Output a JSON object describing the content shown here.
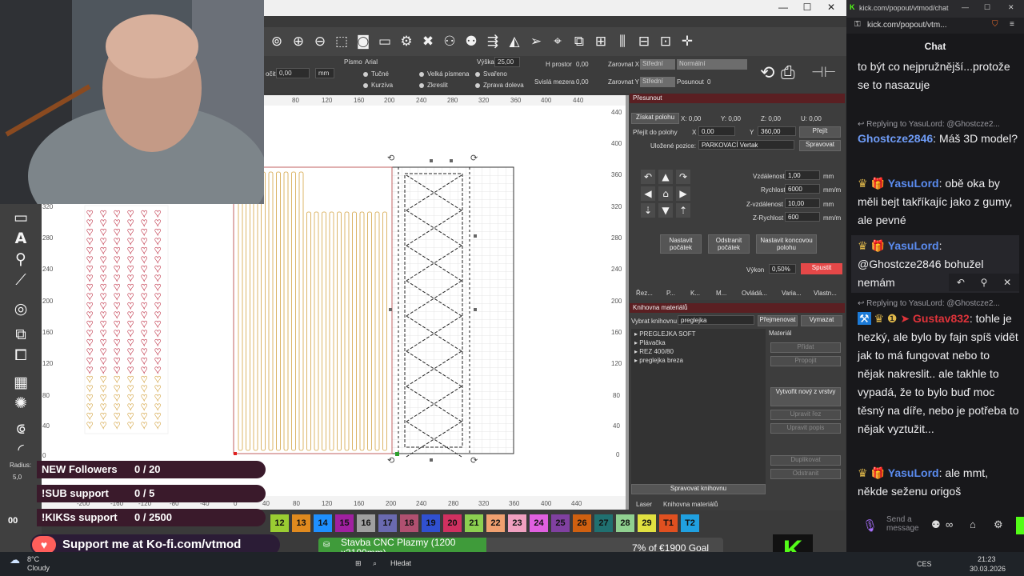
{
  "window": {
    "minimize": "—",
    "maximize": "☐",
    "close": "✕"
  },
  "text_toolbar": {
    "rotate_label": "očit",
    "rotate_value": "0,00",
    "unit": "mm",
    "font_label": "Písmo",
    "font_value": "Arial",
    "height_label": "Výška",
    "height_value": "25,00",
    "hspace_label": "H prostor",
    "hspace_value": "0,00",
    "vspace_label": "Svislá mezera",
    "vspace_value": "0,00",
    "align_x_label": "Zarovnat X",
    "align_x_value": "Střední",
    "align_y_label": "Zarovnat Y",
    "align_y_value": "Střední",
    "normal_value": "Normální",
    "offset_label": "Posunout",
    "offset_value": "0",
    "bold": "Tučné",
    "italic": "Kurzíva",
    "upper": "Velká písmena",
    "distort": "Zkreslit",
    "welded": "Svařeno",
    "rtl": "Zprava doleva"
  },
  "ruler": {
    "top": [
      "80",
      "120",
      "160",
      "200",
      "240",
      "280",
      "320",
      "360",
      "400",
      "440"
    ],
    "bottom": [
      "-200",
      "-160",
      "-120",
      "-80",
      "-40",
      "0",
      "40",
      "80",
      "120",
      "160",
      "200",
      "240",
      "280",
      "320",
      "360",
      "400",
      "440"
    ],
    "left": [
      "320",
      "280",
      "240",
      "200",
      "160",
      "120",
      "80",
      "40",
      "0"
    ],
    "right": [
      "440",
      "400",
      "360",
      "320",
      "280",
      "240",
      "200",
      "160",
      "120",
      "80",
      "40",
      "0"
    ]
  },
  "left_tools": {
    "radius_label": "Radius:",
    "radius_value": "5,0"
  },
  "move_panel": {
    "title": "Přesunout",
    "get_position": "Získat polohu",
    "x": "X: 0,00",
    "y": "Y: 0,00",
    "z": "Z: 0,00",
    "u": "U: 0,00",
    "goto_label": "Přejít do polohy",
    "goto_x_label": "X",
    "goto_x": "0,00",
    "goto_y_label": "Y",
    "goto_y": "360,00",
    "goto_button": "Přejít",
    "saved_label": "Uložené pozice:",
    "saved_value": "PARKOVACÍ Vertak",
    "manage_button": "Spravovat",
    "distance_label": "Vzdálenost",
    "distance_value": "1,00",
    "distance_unit": "mm",
    "speed_label": "Rychlost",
    "speed_value": "6000",
    "speed_unit": "mm/m",
    "zdist_label": "Z-vzdálenost",
    "zdist_value": "10,00",
    "zdist_unit": "mm",
    "zspeed_label": "Z-Rychlost",
    "zspeed_value": "600",
    "zspeed_unit": "mm/m",
    "set_origin": "Nastavit počátek",
    "clear_origin": "Odstranit počátek",
    "set_end": "Nastavit koncovou polohu",
    "power_label": "Výkon",
    "power_value": "0,50%",
    "fire_button": "Spustit"
  },
  "panel_tabs": [
    "Řez...",
    "P...",
    "K...",
    "M...",
    "Ovládá...",
    "Varia...",
    "Vlastn..."
  ],
  "library": {
    "title": "Knihovna materiálů",
    "select_label": "Vybrat knihovnu",
    "select_value": "preglejka",
    "rename_button": "Přejmenovat",
    "delete_button": "Vymazat",
    "items": [
      "PREGLEJKA SOFT",
      "Plávačka",
      "REZ 400/80",
      "preglejka breza"
    ],
    "material_label": "Materiál",
    "add": "Přidat",
    "link": "Propojit",
    "create": "Vytvořit nový z vrstvy",
    "edit_cut": "Upravit řez",
    "edit_desc": "Upravit popis",
    "duplicate": "Duplikovat",
    "remove": "Odstranit",
    "manage": "Spravovat knihovnu",
    "bottom_tab_1": "Laser",
    "bottom_tab_2": "Knihovna materiálů"
  },
  "overlay": {
    "followers_label": "NEW Followers",
    "followers_value": "0 / 20",
    "sub_label": "!SUB support",
    "sub_value": "0 / 5",
    "kicks_label": "!KIKSs support",
    "kicks_value": "0 / 2500",
    "kofi_text": "Support me at Ko-fi.com/vtmod",
    "goal_title": "Stavba CNC Plazmy (1200 x2100mm)",
    "goal_progress": "7% of €1900 Goal"
  },
  "palette": {
    "prefix": "00",
    "swatches": [
      {
        "label": "12",
        "color": "#9acd32"
      },
      {
        "label": "13",
        "color": "#e08a1e"
      },
      {
        "label": "14",
        "color": "#1e90ff"
      },
      {
        "label": "15",
        "color": "#a020a0"
      },
      {
        "label": "16",
        "color": "#a0a0a0"
      },
      {
        "label": "17",
        "color": "#6a6ab0"
      },
      {
        "label": "18",
        "color": "#b05070"
      },
      {
        "label": "19",
        "color": "#3050d0"
      },
      {
        "label": "20",
        "color": "#d03060"
      },
      {
        "label": "21",
        "color": "#8cd050"
      },
      {
        "label": "22",
        "color": "#f0a070"
      },
      {
        "label": "23",
        "color": "#f0a0c0"
      },
      {
        "label": "24",
        "color": "#e060e0"
      },
      {
        "label": "25",
        "color": "#8040a0"
      },
      {
        "label": "26",
        "color": "#d06010"
      },
      {
        "label": "27",
        "color": "#207070"
      },
      {
        "label": "28",
        "color": "#90d090"
      },
      {
        "label": "29",
        "color": "#e0e040"
      },
      {
        "label": "T1",
        "color": "#e05020"
      },
      {
        "label": "T2",
        "color": "#20a0e0"
      }
    ]
  },
  "taskbar": {
    "weather_temp": "8°C",
    "weather_desc": "Cloudy",
    "search": "Hledat",
    "lang": "CES",
    "time": "21:23",
    "date": "30.03.2026"
  },
  "chat": {
    "tab_title": "kick.com/popout/vtmod/chat...",
    "url": "kick.com/popout/vtm...",
    "header": "Chat",
    "messages": [
      {
        "text": "to být co nejpružnější...protože se to nasazuje"
      },
      {
        "reply": "Replying to YasuLord: @Ghostcze2...",
        "user": "Ghostcze2846",
        "color": "#6f9cf7",
        "text": " Máš 3D model?"
      },
      {
        "user": "YasuLord",
        "color": "#5b8cf0",
        "text": " obě oka by měli bejt takříkajíc jako z gumy, ale pevné"
      },
      {
        "user": "YasuLord",
        "color": "#5b8cf0",
        "text": " @Ghostcze2846 bohužel nemám"
      },
      {
        "reply": "Replying to YasuLord: @Ghostcze2...",
        "user": "Gustav832",
        "color": "#e0333a",
        "text": " tohle je hezký, ale bylo by fajn spíš vidět jak to má fungovat nebo to nějak nakreslit.. ale takhle to vypadá, že to bylo buď moc těsný na díře, nebo je potřeba to nějak vyztužit..."
      },
      {
        "user": "YasuLord",
        "color": "#5b8cf0",
        "text": " ale mmt, někde seženu origoš"
      }
    ],
    "input_placeholder": "Send a message"
  }
}
